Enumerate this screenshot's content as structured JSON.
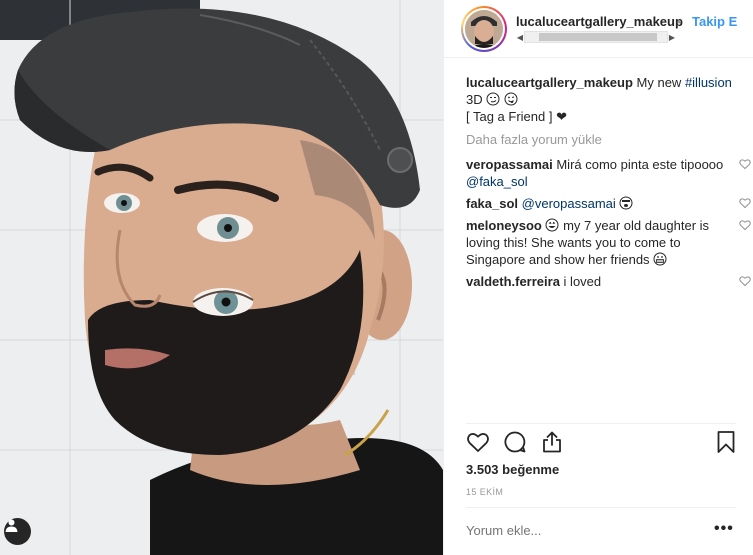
{
  "post": {
    "author": "lucaluceartgallery_makeup",
    "header_separator": "•",
    "follow_label": "Takip E",
    "caption": {
      "username": "lucaluceartgallery_makeup",
      "text_before": " My new ",
      "hashtag": "#illusion",
      "line2": "3D",
      "line3": "[ Tag a Friend ]",
      "heart": "❤"
    },
    "load_more": "Daha fazla yorum yükle",
    "comments": [
      {
        "username": "veropassamai",
        "text": " Mirá como pinta este tipoooo ",
        "mention": "@faka_sol",
        "emoji": ""
      },
      {
        "username": "faka_sol",
        "text": " ",
        "mention": "@veropassamai",
        "emoji": "face"
      },
      {
        "username": "meloneysoo",
        "text": " my 7 year old daughter is loving this! She wants you to come to Singapore and show her friends ",
        "mention": "",
        "emoji": ""
      },
      {
        "username": "valdeth.ferreira",
        "text": " i loved",
        "mention": "",
        "emoji": ""
      }
    ],
    "likes": "3.503 beğenme",
    "date": "15 EKİM",
    "add_comment_placeholder": "Yorum ekle...",
    "more_options": "•••"
  },
  "icons": {
    "like": "heart-icon",
    "comment": "comment-bubble-icon",
    "share": "share-icon",
    "save": "bookmark-icon",
    "user_tags": "user-tag-icon"
  },
  "colors": {
    "link_blue": "#3897f0",
    "hashtag_dark_blue": "#003569",
    "muted_gray": "#999999"
  }
}
